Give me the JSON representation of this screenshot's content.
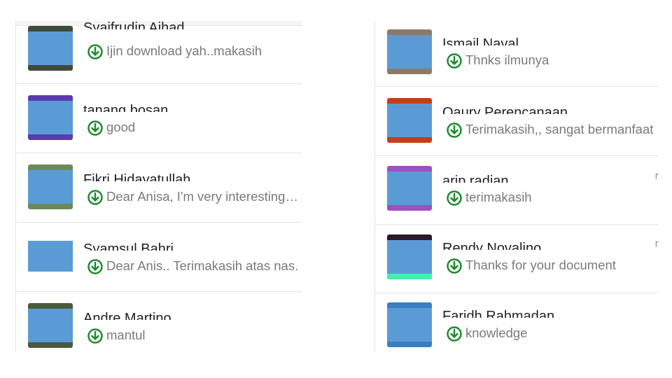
{
  "left_comments": [
    {
      "name": "Syaifrudin Ajhad",
      "message": "Ijin download yah..makasih",
      "icon": "download-circle-icon",
      "avatar_color": "#3f4a3a"
    },
    {
      "name": "tanang bosan",
      "message": "good",
      "icon": "download-circle-icon",
      "avatar_color": "#5a3bb0"
    },
    {
      "name": "Fikri Hidayatullah",
      "message": "Dear Anisa, I'm very interesting a..",
      "icon": "download-circle-icon",
      "avatar_color": "#6a8a5a"
    },
    {
      "name": "Syamsul Bahri",
      "message": "Dear Anis.. Terimakasih atas nas.",
      "icon": "download-circle-icon",
      "avatar_color": "#8a3a3a"
    },
    {
      "name": "Andre Martino",
      "message": "mantul",
      "icon": "download-circle-icon",
      "avatar_color": "#4a5a3a"
    }
  ],
  "right_comments": [
    {
      "name": "Ismail Naval",
      "message": "Thnks ilmunya",
      "icon": "download-circle-icon",
      "avatar_color": "#8a7a6a"
    },
    {
      "name": "Qaury Perencanaan",
      "message": "Terimakasih,, sangat bermanfaat",
      "icon": "download-circle-icon",
      "avatar_color": "#c0401a"
    },
    {
      "name": "arip radian",
      "message": "terimakasih",
      "icon": "download-circle-icon",
      "avatar_color": "#a04ec0",
      "more": "r"
    },
    {
      "name": "Rendy Novalino",
      "message": "Thanks for your document",
      "icon": "download-circle-icon",
      "avatar_color": "#2a1a2a",
      "more": "r"
    },
    {
      "name": "Faridh Rahmadan",
      "message": "knowledge",
      "icon": "download-circle-icon",
      "avatar_color": "#3a7fc0"
    }
  ],
  "colors": {
    "accent_download": "#1e8a2e",
    "avatar_mask": "#5b9bd5",
    "message_text": "#7a7a7a"
  }
}
